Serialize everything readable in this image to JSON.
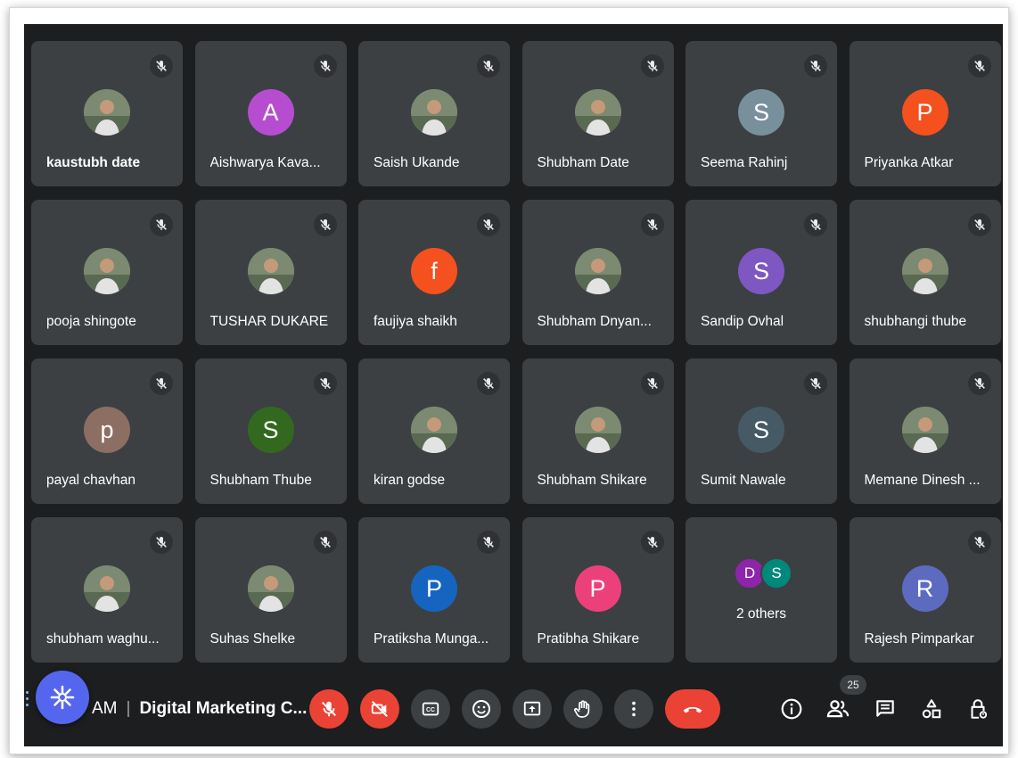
{
  "participants": [
    {
      "name": "kaustubh date",
      "avatar_type": "photo",
      "bold": true
    },
    {
      "name": "Aishwarya Kava...",
      "avatar_type": "letter",
      "initial": "A",
      "color": "#b64dd1"
    },
    {
      "name": "Saish Ukande",
      "avatar_type": "photo"
    },
    {
      "name": "Shubham Date",
      "avatar_type": "photo"
    },
    {
      "name": "Seema Rahinj",
      "avatar_type": "letter",
      "initial": "S",
      "color": "#78909c"
    },
    {
      "name": "Priyanka Atkar",
      "avatar_type": "letter",
      "initial": "P",
      "color": "#f4511e"
    },
    {
      "name": "pooja shingote",
      "avatar_type": "photo"
    },
    {
      "name": "TUSHAR DUKARE",
      "avatar_type": "photo"
    },
    {
      "name": "faujiya shaikh",
      "avatar_type": "letter",
      "initial": "f",
      "color": "#f4511e"
    },
    {
      "name": "Shubham Dnyan...",
      "avatar_type": "photo"
    },
    {
      "name": "Sandip Ovhal",
      "avatar_type": "letter",
      "initial": "S",
      "color": "#7e57c2"
    },
    {
      "name": "shubhangi thube",
      "avatar_type": "photo"
    },
    {
      "name": "payal chavhan",
      "avatar_type": "letter",
      "initial": "p",
      "color": "#8d6e63"
    },
    {
      "name": "Shubham Thube",
      "avatar_type": "letter",
      "initial": "S",
      "color": "#33691e"
    },
    {
      "name": "kiran godse",
      "avatar_type": "photo"
    },
    {
      "name": "Shubham Shikare",
      "avatar_type": "photo"
    },
    {
      "name": "Sumit Nawale",
      "avatar_type": "letter",
      "initial": "S",
      "color": "#455a64"
    },
    {
      "name": "Memane Dinesh ...",
      "avatar_type": "photo"
    },
    {
      "name": "shubham waghu...",
      "avatar_type": "photo"
    },
    {
      "name": "Suhas Shelke",
      "avatar_type": "photo"
    },
    {
      "name": "Pratiksha Munga...",
      "avatar_type": "letter",
      "initial": "P",
      "color": "#1565c0"
    },
    {
      "name": "Pratibha Shikare",
      "avatar_type": "letter",
      "initial": "P",
      "color": "#ec407a"
    },
    {
      "name": "2 others",
      "avatar_type": "group",
      "initials": [
        "D",
        "S"
      ],
      "colors": [
        "#8e24aa",
        "#00897b"
      ]
    },
    {
      "name": "Rajesh Pimparkar",
      "avatar_type": "letter",
      "initial": "R",
      "color": "#5c6bc0"
    }
  ],
  "bottom_bar": {
    "time": "AM",
    "meeting_title": "Digital Marketing C...",
    "participant_count": "25",
    "controls": [
      "mic-off",
      "camera-off",
      "captions",
      "emoji",
      "present",
      "raise-hand",
      "more-options",
      "leave-call"
    ],
    "right_controls": [
      "meeting-details",
      "people",
      "chat",
      "activities",
      "host-controls"
    ]
  },
  "colors": {
    "background": "#1d1e20",
    "tile": "#3c4043",
    "danger": "#ea4335",
    "fab": "#5566ee"
  }
}
